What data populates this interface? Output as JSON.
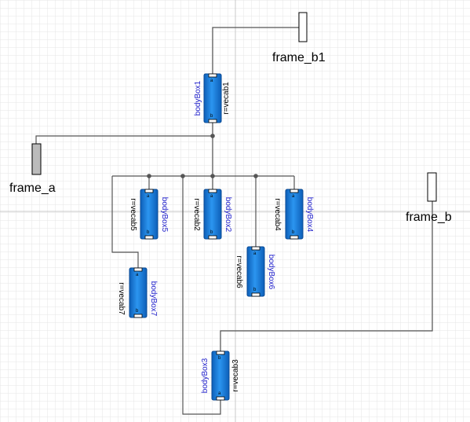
{
  "diagram": {
    "frames": [
      {
        "id": "frame_b1",
        "label": "frame_b1"
      },
      {
        "id": "frame_a",
        "label": "frame_a"
      },
      {
        "id": "frame_b",
        "label": "frame_b"
      }
    ],
    "boxes": [
      {
        "id": "bodyBox1",
        "name": "bodyBox1",
        "param": "r=vecab1"
      },
      {
        "id": "bodyBox5",
        "name": "bodyBox5",
        "param": "r=vecab5"
      },
      {
        "id": "bodyBox2",
        "name": "bodyBox2",
        "param": "r=vecab2"
      },
      {
        "id": "bodyBox4",
        "name": "bodyBox4",
        "param": "r=vecab4"
      },
      {
        "id": "bodyBox6",
        "name": "bodyBox6",
        "param": "r=vecab6"
      },
      {
        "id": "bodyBox7",
        "name": "bodyBox7",
        "param": "r=vecab7"
      },
      {
        "id": "bodyBox3",
        "name": "bodyBox3",
        "param": "r=vecab3"
      }
    ],
    "pin_a": "a",
    "pin_b": "b",
    "colors": {
      "box_fill": "#1e88e5",
      "box_name": "#2222cc",
      "wire": "#555555",
      "frame_a_fill": "#bbbbbb",
      "frame_b_fill": "#ffffff",
      "grid": "#e2e2e2"
    }
  }
}
